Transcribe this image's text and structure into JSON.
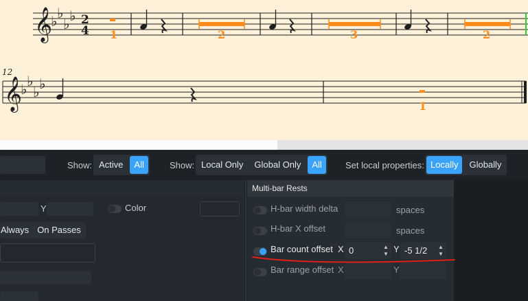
{
  "score": {
    "time_signature": {
      "top": "2",
      "bottom": "4"
    },
    "measure_number": "12",
    "multirest_counts": [
      "1",
      "2",
      "3",
      "2",
      "1"
    ],
    "accent_color": "#ff8c1a",
    "staff_color": "#1f1f1f"
  },
  "toolbar": {
    "show_label_1": "Show:",
    "show_options_1": [
      {
        "label": "Active",
        "active": false
      },
      {
        "label": "All",
        "active": true
      }
    ],
    "show_label_2": "Show:",
    "show_options_2": [
      {
        "label": "Local Only",
        "active": false
      },
      {
        "label": "Global Only",
        "active": false
      },
      {
        "label": "All",
        "active": true
      }
    ],
    "set_local_label": "Set local properties:",
    "set_local_options": [
      {
        "label": "Locally",
        "active": true
      },
      {
        "label": "Globally",
        "active": false
      }
    ]
  },
  "left_section": {
    "y_axis": "Y",
    "color_label": "Color",
    "always_label": "Always",
    "on_passes_label": "On Passes"
  },
  "multibar_rests": {
    "title": "Multi-bar Rests",
    "rows": [
      {
        "label": "H-bar width delta",
        "enabled": false,
        "unit": "spaces"
      },
      {
        "label": "H-bar X offset",
        "enabled": false,
        "unit": "spaces"
      },
      {
        "label": "Bar count offset",
        "enabled": true,
        "x_axis": "X",
        "x_value": "0",
        "y_axis": "Y",
        "y_value": "-5 1/2"
      },
      {
        "label": "Bar range offset",
        "enabled": false,
        "x_axis": "X",
        "y_axis": "Y"
      }
    ]
  },
  "colors": {
    "active_accent": "#3aa3ff",
    "annotation_red": "#e0201a"
  }
}
